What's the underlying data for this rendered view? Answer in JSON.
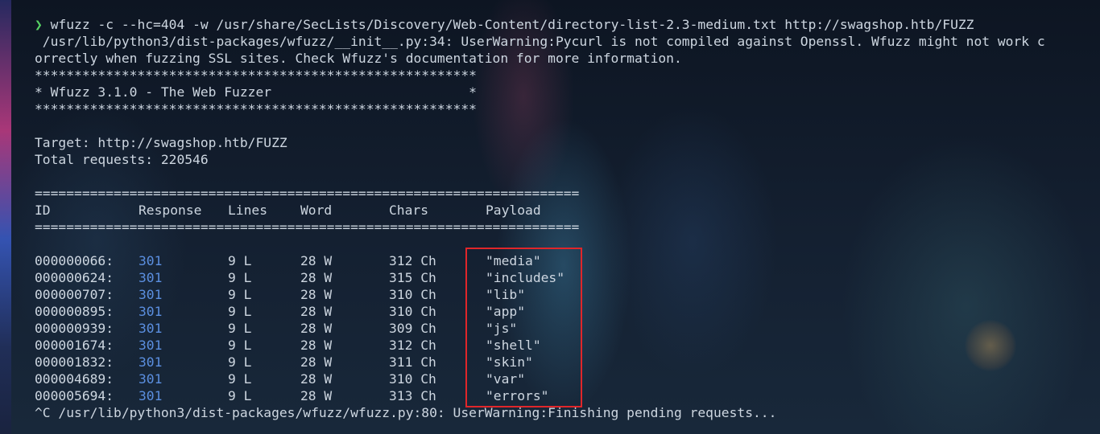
{
  "terminal": {
    "prompt_symbol": "❯",
    "command": "wfuzz -c --hc=404 -w /usr/share/SecLists/Discovery/Web-Content/directory-list-2.3-medium.txt http://swagshop.htb/FUZZ",
    "warning_line1": " /usr/lib/python3/dist-packages/wfuzz/__init__.py:34: UserWarning:Pycurl is not compiled against Openssl. Wfuzz might not work c",
    "warning_line2": "orrectly when fuzzing SSL sites. Check Wfuzz's documentation for more information.",
    "banner_stars": "********************************************************",
    "banner_title": "* Wfuzz 3.1.0 - The Web Fuzzer                         *",
    "target": "Target: http://swagshop.htb/FUZZ",
    "total_requests": "Total requests: 220546",
    "separator": "=====================================================================",
    "headers": {
      "id": "ID",
      "response": "Response",
      "lines": "Lines",
      "word": "Word",
      "chars": "Chars",
      "payload": "Payload"
    },
    "rows": [
      {
        "id": "000000066:",
        "response": "301",
        "lines": "9 L",
        "word": "28 W",
        "chars": "312 Ch",
        "payload": "\"media\""
      },
      {
        "id": "000000624:",
        "response": "301",
        "lines": "9 L",
        "word": "28 W",
        "chars": "315 Ch",
        "payload": "\"includes\""
      },
      {
        "id": "000000707:",
        "response": "301",
        "lines": "9 L",
        "word": "28 W",
        "chars": "310 Ch",
        "payload": "\"lib\""
      },
      {
        "id": "000000895:",
        "response": "301",
        "lines": "9 L",
        "word": "28 W",
        "chars": "310 Ch",
        "payload": "\"app\""
      },
      {
        "id": "000000939:",
        "response": "301",
        "lines": "9 L",
        "word": "28 W",
        "chars": "309 Ch",
        "payload": "\"js\""
      },
      {
        "id": "000001674:",
        "response": "301",
        "lines": "9 L",
        "word": "28 W",
        "chars": "312 Ch",
        "payload": "\"shell\""
      },
      {
        "id": "000001832:",
        "response": "301",
        "lines": "9 L",
        "word": "28 W",
        "chars": "311 Ch",
        "payload": "\"skin\""
      },
      {
        "id": "000004689:",
        "response": "301",
        "lines": "9 L",
        "word": "28 W",
        "chars": "310 Ch",
        "payload": "\"var\""
      },
      {
        "id": "000005694:",
        "response": "301",
        "lines": "9 L",
        "word": "28 W",
        "chars": "313 Ch",
        "payload": "\"errors\""
      }
    ],
    "final_line": "^C /usr/lib/python3/dist-packages/wfuzz/wfuzz.py:80: UserWarning:Finishing pending requests..."
  },
  "colors": {
    "prompt_arrow": "#56d364",
    "text": "#cdd6e0",
    "status_301": "#5b8fe0",
    "highlight_box": "#e0262a",
    "background": "#101827"
  }
}
